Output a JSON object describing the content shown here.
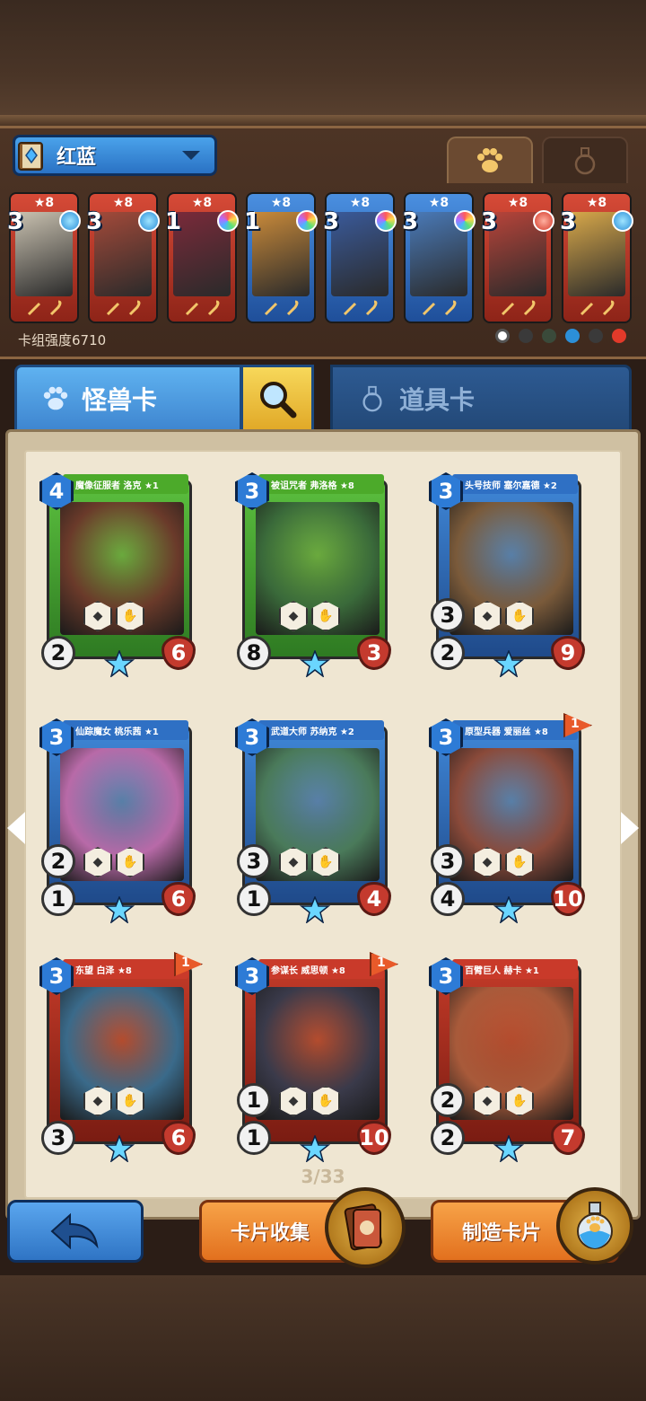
{
  "deck": {
    "name": "红蓝",
    "strength_label": "卡组强度6710"
  },
  "top_tabs": [
    "paw",
    "flask"
  ],
  "deck_cards": [
    {
      "stars": "★8",
      "cost": "3",
      "color": "red",
      "gem": "blue",
      "art": "#c9c1b0"
    },
    {
      "stars": "★8",
      "cost": "3",
      "color": "red",
      "gem": "blue",
      "art": "#a34a3a"
    },
    {
      "stars": "★8",
      "cost": "1",
      "color": "red",
      "gem": "rainbow",
      "art": "#7a2a3a"
    },
    {
      "stars": "★8",
      "cost": "1",
      "color": "blue",
      "gem": "rainbow",
      "art": "#c98a3a"
    },
    {
      "stars": "★8",
      "cost": "3",
      "color": "blue",
      "gem": "rainbow",
      "art": "#3a5a9a"
    },
    {
      "stars": "★8",
      "cost": "3",
      "color": "blue",
      "gem": "rainbow",
      "art": "#4a7ab8"
    },
    {
      "stars": "★8",
      "cost": "3",
      "color": "red",
      "gem": "red",
      "art": "#b8443a"
    },
    {
      "stars": "★8",
      "cost": "3",
      "color": "red",
      "gem": "blue",
      "art": "#d8a84a"
    }
  ],
  "tabs": {
    "monster": "怪兽卡",
    "items": "道具卡"
  },
  "cards": [
    {
      "name": "魔像征服者 洛克 ★1",
      "cost": "4",
      "atk": "2",
      "hp": "6",
      "extra": "",
      "color": "green",
      "art": "#6a3a2a",
      "flag": ""
    },
    {
      "name": "被诅咒者 弗洛格 ★8",
      "cost": "3",
      "atk": "8",
      "hp": "3",
      "extra": "",
      "color": "green",
      "art": "#3a6a3a",
      "flag": ""
    },
    {
      "name": "头号技师 塞尔嘉德 ★2",
      "cost": "3",
      "atk": "2",
      "hp": "9",
      "extra": "3",
      "color": "blue",
      "art": "#7a5a3a",
      "flag": ""
    },
    {
      "name": "仙踪魔女 桃乐茜 ★1",
      "cost": "3",
      "atk": "1",
      "hp": "6",
      "extra": "2",
      "color": "blue",
      "art": "#b86aa8",
      "flag": ""
    },
    {
      "name": "武道大师 苏纳克 ★2",
      "cost": "3",
      "atk": "1",
      "hp": "4",
      "extra": "3",
      "color": "blue",
      "art": "#4a7a5a",
      "flag": ""
    },
    {
      "name": "原型兵器 爱丽丝 ★8",
      "cost": "3",
      "atk": "4",
      "hp": "10",
      "extra": "3",
      "color": "blue",
      "art": "#8a4a3a",
      "flag": "1"
    },
    {
      "name": "东望 白泽 ★8",
      "cost": "3",
      "atk": "3",
      "hp": "6",
      "extra": "",
      "color": "red",
      "art": "#3a6a8a",
      "flag": "1"
    },
    {
      "name": "参谋长 威思顿 ★8",
      "cost": "3",
      "atk": "1",
      "hp": "10",
      "extra": "1",
      "color": "red",
      "art": "#3a3a4a",
      "flag": "1"
    },
    {
      "name": "百臂巨人 赫卡 ★1",
      "cost": "3",
      "atk": "2",
      "hp": "7",
      "extra": "2",
      "color": "red",
      "art": "#a85a3a",
      "flag": ""
    }
  ],
  "pager": "3/33",
  "buttons": {
    "collect": "卡片收集",
    "craft": "制造卡片"
  }
}
